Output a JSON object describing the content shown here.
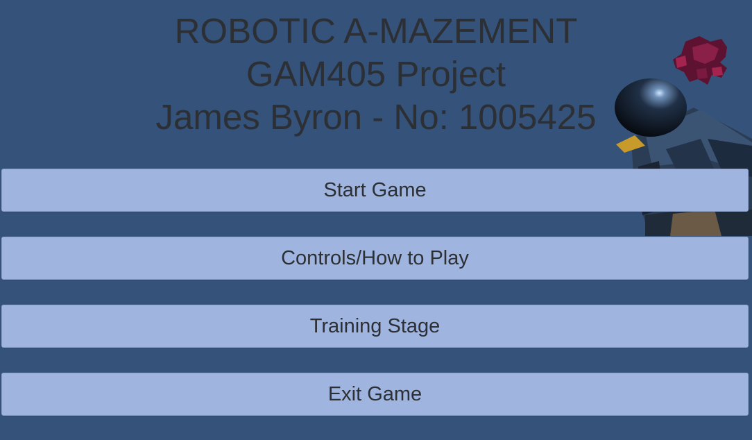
{
  "title": {
    "line1": "ROBOTIC A-MAZEMENT",
    "line2": "GAM405 Project",
    "line3": "James Byron - No: 1005425"
  },
  "menu": {
    "items": [
      {
        "label": "Start Game"
      },
      {
        "label": "Controls/How to Play"
      },
      {
        "label": "Training Stage"
      },
      {
        "label": "Exit Game"
      }
    ]
  },
  "colors": {
    "background": "#34527a",
    "button": "#9fb5e0",
    "text": "#2c2f33"
  }
}
